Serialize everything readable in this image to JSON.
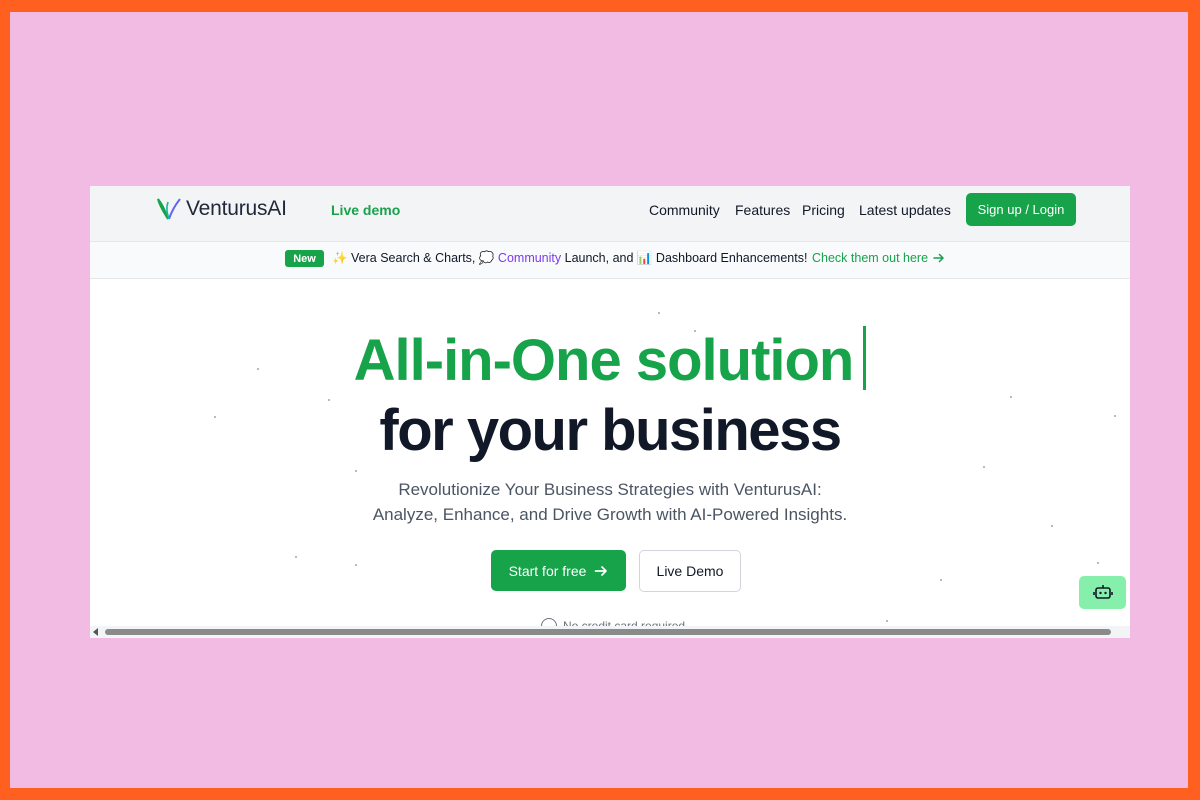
{
  "header": {
    "brand": "VenturusAI",
    "live_demo": "Live demo",
    "nav": [
      "Community",
      "Features",
      "Pricing",
      "Latest updates"
    ],
    "signup": "Sign up / Login"
  },
  "announcement": {
    "badge": "New",
    "part1": "✨ Vera Search & Charts, 💭 ",
    "part_highlight": "Community",
    "part2": " Launch, and 📊 Dashboard Enhancements!",
    "link": "Check them out here"
  },
  "hero": {
    "line1": "All-in-One solution",
    "line2": "for your business",
    "subtitle_1": "Revolutionize Your Business Strategies with VenturusAI:",
    "subtitle_2": "Analyze, Enhance, and Drive Growth with AI-Powered Insights.",
    "cta_primary": "Start for free",
    "cta_secondary": "Live Demo",
    "note": "No credit card required"
  },
  "icons": {
    "logo": "v-leaf-logo-icon",
    "arrow": "arrow-right-icon",
    "chat": "chat-bot-icon",
    "check": "circle-check-icon"
  },
  "colors": {
    "frame_outer": "#ff5f1f",
    "frame_inner": "#f1bbe4",
    "accent": "#16a34a",
    "heading": "#111827",
    "chat_bg": "#86efac"
  }
}
